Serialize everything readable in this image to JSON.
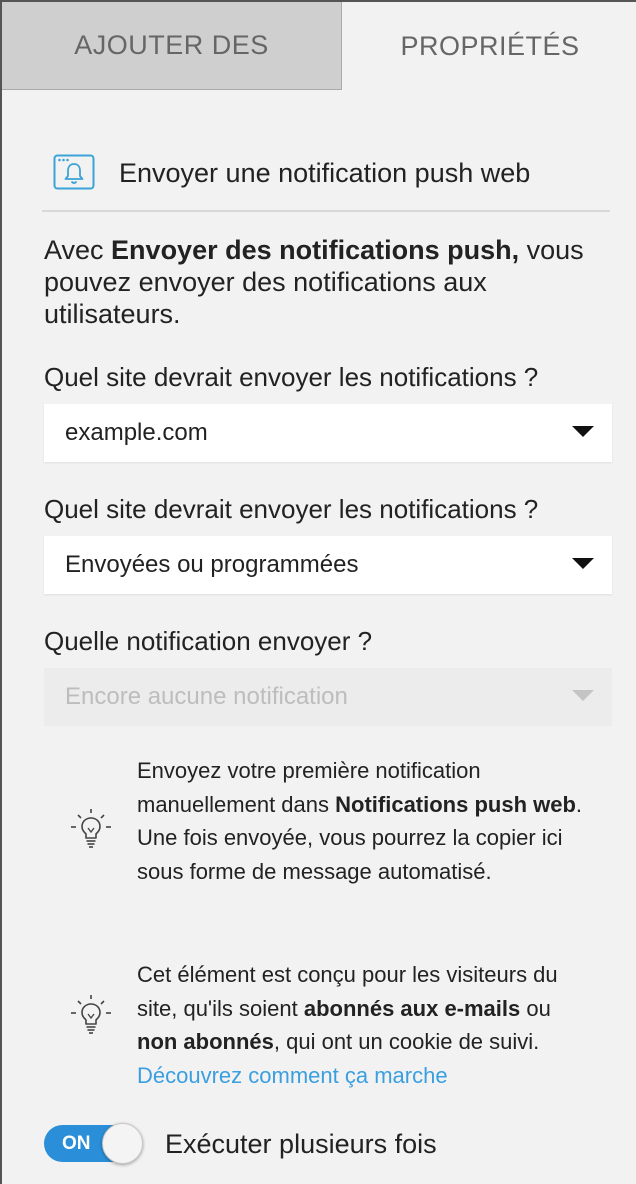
{
  "tabs": {
    "add_label": "AJOUTER DES",
    "properties_label": "PROPRIÉTÉS"
  },
  "header": {
    "icon": "browser-bell-icon",
    "title": "Envoyer une notification push web"
  },
  "intro": {
    "prefix": "Avec ",
    "bold": "Envoyer des notifications push,",
    "suffix": " vous pouvez envoyer des notifications aux utilisateurs."
  },
  "site_field": {
    "label": "Quel site devrait envoyer les notifications ?",
    "value": "example.com"
  },
  "status_field": {
    "label": "Quel site devrait envoyer les notifications ?",
    "value": "Envoyées ou programmées"
  },
  "notification_field": {
    "label": "Quelle notification envoyer ?",
    "placeholder": "Encore aucune notification",
    "disabled": true
  },
  "tip1": {
    "icon": "lightbulb-icon",
    "t1": "Envoyez votre première notification manuellement dans ",
    "b1": "Notifications push web",
    "t2": ". Une fois envoyée, vous pourrez la copier ici sous forme de message automatisé."
  },
  "tip2": {
    "icon": "lightbulb-icon",
    "t1": "Cet élément est conçu pour les visiteurs du site, qu'ils soient ",
    "b1": "abonnés aux e-mails",
    "t2": " ou ",
    "b2": "non abonnés",
    "t3": ", qui ont un cookie de suivi. ",
    "link": "Découvrez comment ça marche"
  },
  "run_multiple": {
    "toggle_text": "ON",
    "label": "Exécuter plusieurs fois",
    "enabled": true
  },
  "colors": {
    "accent": "#2a8fd8",
    "link": "#3a9fe0",
    "icon": "#3aa3d8"
  }
}
